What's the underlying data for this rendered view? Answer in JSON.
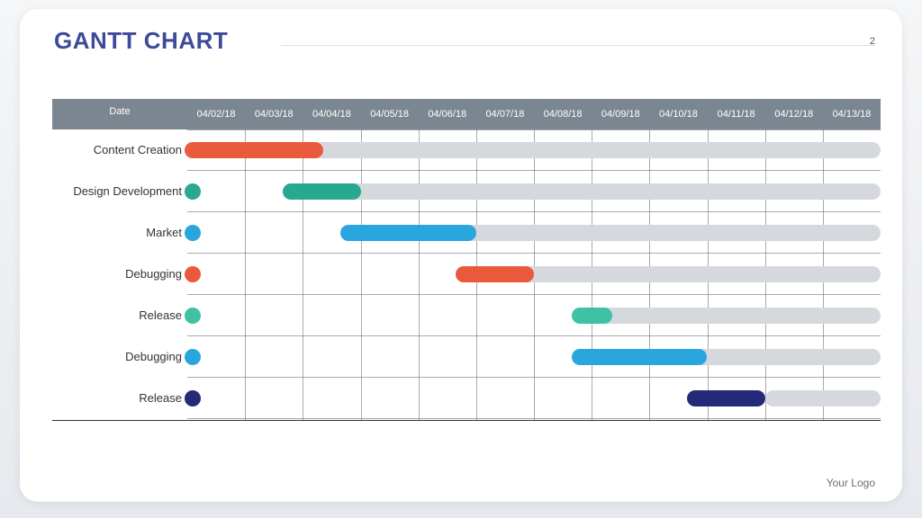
{
  "title": "GANTT CHART",
  "page_number": "2",
  "footer": "Your Logo",
  "header_label": "Date",
  "chart_data": {
    "type": "gantt",
    "title": "GANTT CHART",
    "xlabel": "Date",
    "x_ticks": [
      "04/02/18",
      "04/03/18",
      "04/04/18",
      "04/05/18",
      "04/06/18",
      "04/07/18",
      "04/08/18",
      "04/09/18",
      "04/10/18",
      "04/11/18",
      "04/12/18",
      "04/13/18"
    ],
    "x_range": [
      "04/02/18",
      "04/13/18"
    ],
    "tasks": [
      {
        "name": "Content Creation",
        "dot_color": "#e85a3b",
        "bar_color": "#e85a3b",
        "bar_start": "04/02/18",
        "bar_end": "04/04/18",
        "track_start": "04/02/18"
      },
      {
        "name": "Design Development",
        "dot_color": "#28a88e",
        "bar_color": "#28a88e",
        "bar_start": "04/04/18",
        "bar_end": "04/05/18",
        "track_start": "04/04/18"
      },
      {
        "name": "Market",
        "dot_color": "#2aa6df",
        "bar_color": "#2aa6df",
        "bar_start": "04/05/18",
        "bar_end": "04/07/18",
        "track_start": "04/05/18"
      },
      {
        "name": "Debugging",
        "dot_color": "#e85a3b",
        "bar_color": "#e85a3b",
        "bar_start": "04/07/18",
        "bar_end": "04/08/18",
        "track_start": "04/07/18"
      },
      {
        "name": "Release",
        "dot_color": "#3fc1a6",
        "bar_color": "#3fc1a6",
        "bar_start": "04/09/18",
        "bar_end": "04/09/18",
        "track_start": "04/09/18"
      },
      {
        "name": "Debugging",
        "dot_color": "#2aa6df",
        "bar_color": "#2aa6df",
        "bar_start": "04/09/18",
        "bar_end": "04/11/18",
        "track_start": "04/09/18"
      },
      {
        "name": "Release",
        "dot_color": "#252a78",
        "bar_color": "#252a78",
        "bar_start": "04/11/18",
        "bar_end": "04/12/18",
        "track_start": "04/12/18"
      }
    ]
  }
}
